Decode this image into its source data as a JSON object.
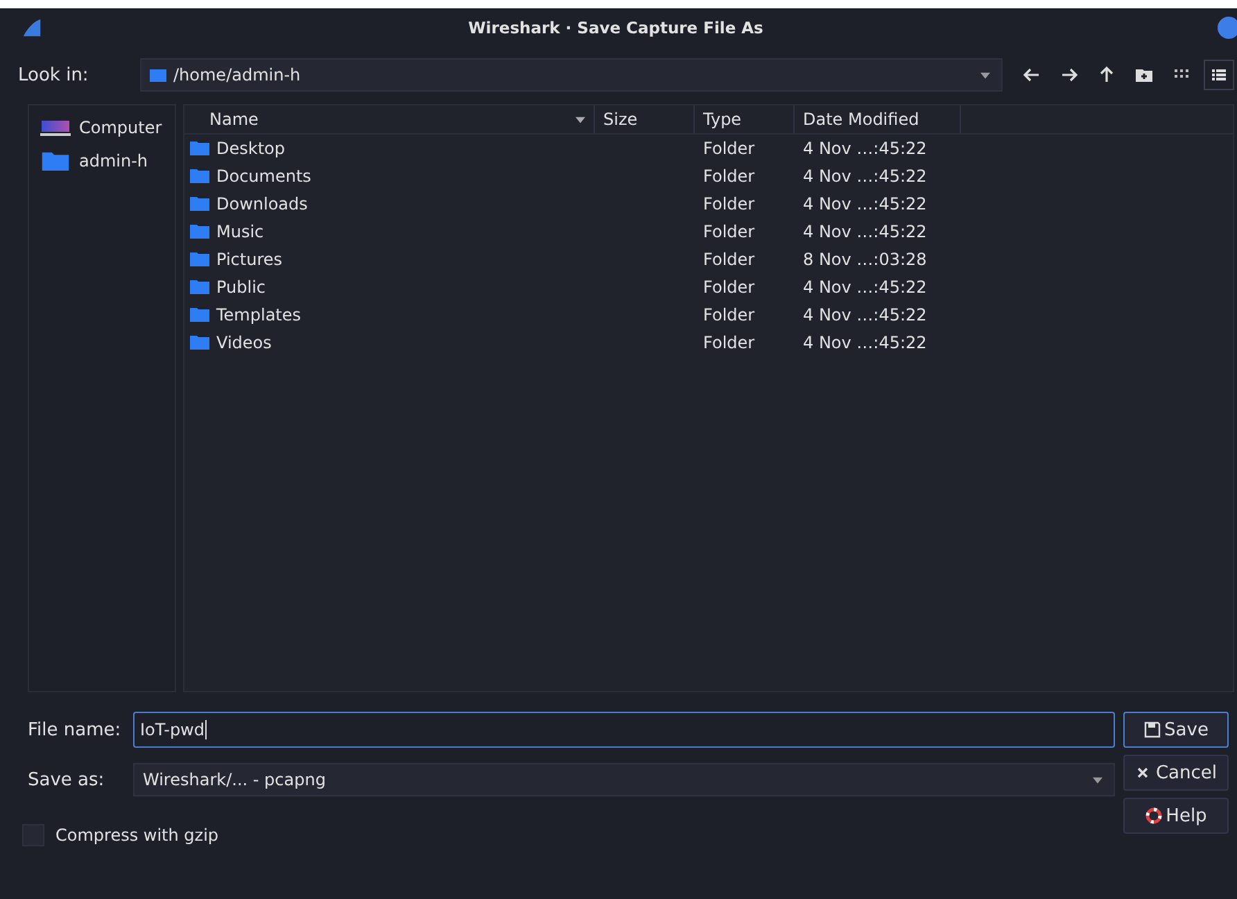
{
  "window": {
    "title": "Wireshark · Save Capture File As"
  },
  "look_in": {
    "label": "Look in:",
    "path": "/home/admin-h"
  },
  "sidebar": {
    "items": [
      {
        "label": "Computer",
        "kind": "computer",
        "selected": false
      },
      {
        "label": "admin-h",
        "kind": "folder",
        "selected": false
      }
    ]
  },
  "table": {
    "columns": [
      "Name",
      "Size",
      "Type",
      "Date Modified"
    ],
    "rows": [
      {
        "name": "Desktop",
        "type": "Folder",
        "date": "4 Nov …:45:22"
      },
      {
        "name": "Documents",
        "type": "Folder",
        "date": "4 Nov …:45:22"
      },
      {
        "name": "Downloads",
        "type": "Folder",
        "date": "4 Nov …:45:22"
      },
      {
        "name": "Music",
        "type": "Folder",
        "date": "4 Nov …:45:22"
      },
      {
        "name": "Pictures",
        "type": "Folder",
        "date": "8 Nov …:03:28"
      },
      {
        "name": "Public",
        "type": "Folder",
        "date": "4 Nov …:45:22"
      },
      {
        "name": "Templates",
        "type": "Folder",
        "date": "4 Nov …:45:22"
      },
      {
        "name": "Videos",
        "type": "Folder",
        "date": "4 Nov …:45:22"
      }
    ]
  },
  "file_name": {
    "label": "File name:",
    "value": "IoT-pwd"
  },
  "save_as": {
    "label": "Save as:",
    "value": "Wireshark/... - pcapng"
  },
  "compress": {
    "label": "Compress with gzip",
    "checked": false
  },
  "buttons": [
    {
      "label": "Save",
      "kind": "save"
    },
    {
      "label": "Cancel",
      "kind": "cancel"
    },
    {
      "label": "Help",
      "kind": "help"
    }
  ]
}
